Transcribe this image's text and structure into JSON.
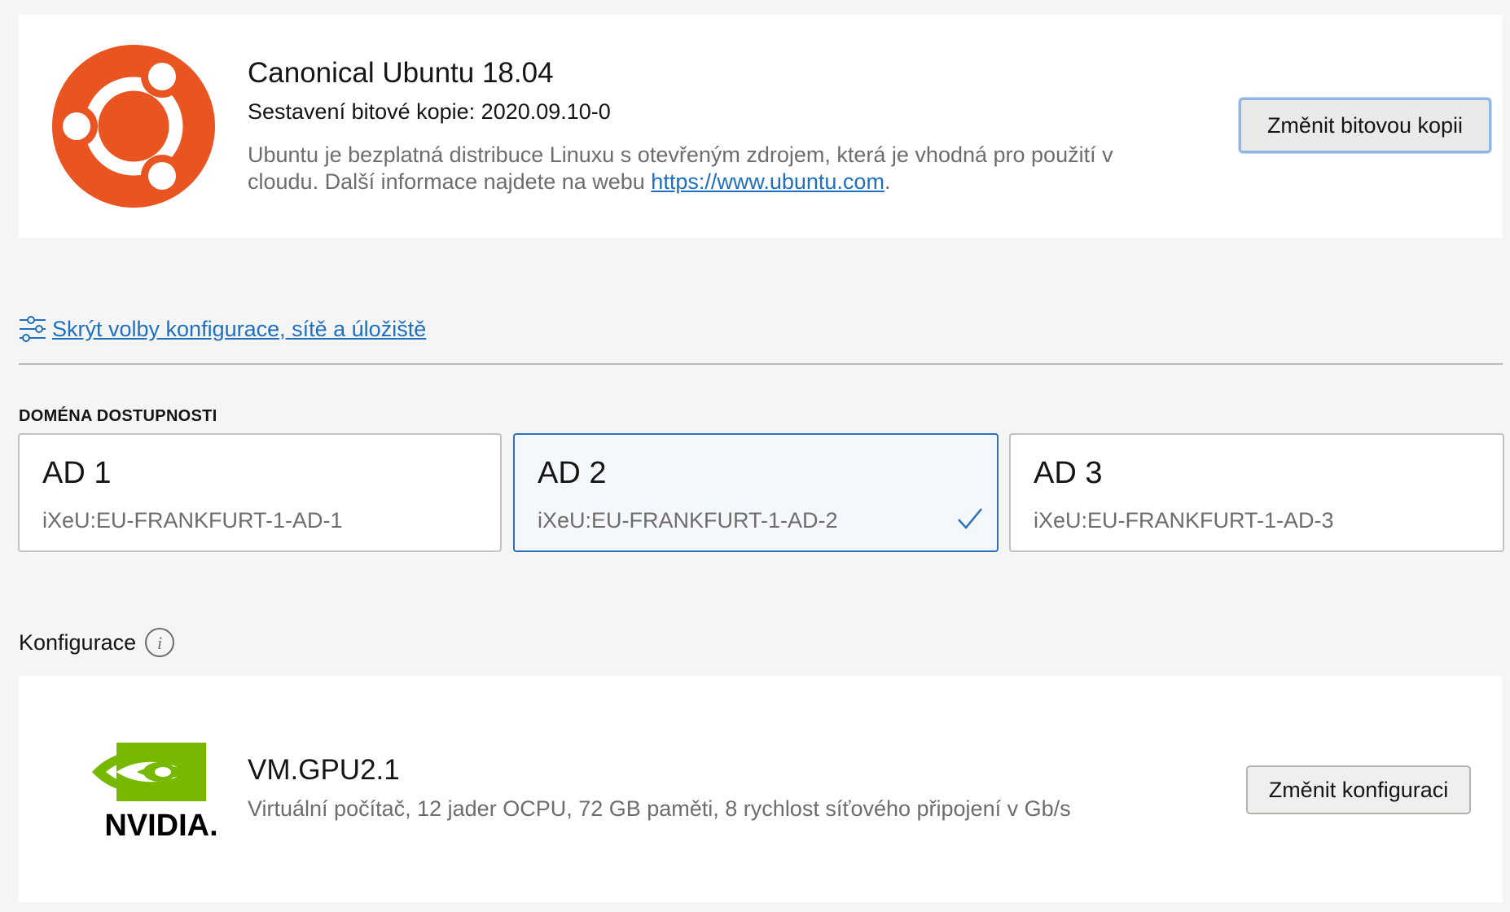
{
  "image": {
    "title": "Canonical Ubuntu 18.04",
    "build_label": "Sestavení bitové kopie: 2020.09.10-0",
    "description_prefix": "Ubuntu je bezplatná distribuce Linuxu s otevřeným zdrojem, která je vhodná pro použití v cloudu. Další informace najdete na webu ",
    "description_link": "https://www.ubuntu.com",
    "description_suffix": ".",
    "change_button": "Změnit bitovou kopii",
    "logo_icon": "ubuntu-logo",
    "logo_color": "#e95420"
  },
  "toggle": {
    "label": "Skrýt volby konfigurace, sítě a úložiště",
    "icon": "sliders-icon"
  },
  "availability_domain": {
    "label": "DOMÉNA DOSTUPNOSTI",
    "selected_index": 1,
    "options": [
      {
        "name": "AD 1",
        "id": "iXeU:EU-FRANKFURT-1-AD-1"
      },
      {
        "name": "AD 2",
        "id": "iXeU:EU-FRANKFURT-1-AD-2"
      },
      {
        "name": "AD 3",
        "id": "iXeU:EU-FRANKFURT-1-AD-3"
      }
    ]
  },
  "shape": {
    "section_title": "Konfigurace",
    "name": "VM.GPU2.1",
    "description": "Virtuální počítač, 12 jader OCPU, 72 GB paměti, 8 rychlost síťového připojení v Gb/s",
    "change_button": "Změnit konfiguraci",
    "logo_text": "NVIDIA.",
    "logo_color": "#76b900"
  },
  "colors": {
    "link": "#1e6fc0",
    "selected_border": "#2e6fb8"
  }
}
